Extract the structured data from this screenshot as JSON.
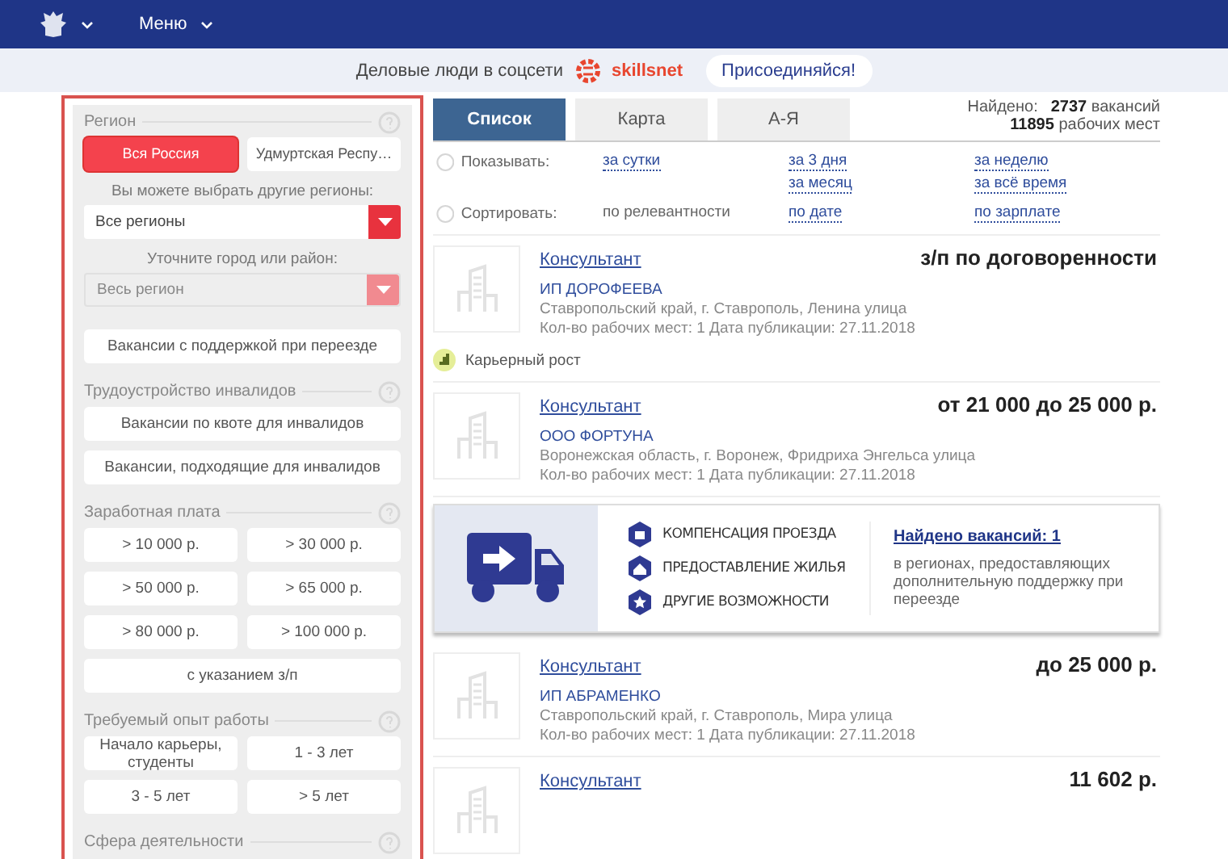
{
  "header": {
    "menu_label": "Меню"
  },
  "banner": {
    "text": "Деловые люди в соцсети",
    "brand": "skillsnet",
    "join_button": "Присоединяйся!"
  },
  "filters": {
    "sections": [
      {
        "kind": "region",
        "title": "Регион",
        "region_buttons": [
          {
            "label": "Вся Россия",
            "selected": true
          },
          {
            "label": "Удмуртская Респу…",
            "selected": false
          }
        ],
        "selects": [
          {
            "label": "Вы можете выбрать другие регионы:",
            "value": "Все регионы",
            "disabled": false
          },
          {
            "label": "Уточните город или район:",
            "value": "Весь регион",
            "disabled": true
          }
        ],
        "buttons": [
          {
            "label": "Вакансии с поддержкой при переезде",
            "selected": false
          }
        ]
      },
      {
        "kind": "buttons",
        "title": "Трудоустройство инвалидов",
        "buttons": [
          {
            "label": "Вакансии по квоте для инвалидов",
            "selected": false
          },
          {
            "label": "Вакансии, подходящие для инвалидов",
            "selected": false
          }
        ]
      },
      {
        "kind": "grid",
        "title": "Заработная плата",
        "buttons": [
          {
            "label": "> 10 000 р.",
            "selected": false
          },
          {
            "label": "> 30 000 р.",
            "selected": false
          },
          {
            "label": "> 50 000 р.",
            "selected": false
          },
          {
            "label": "> 65 000 р.",
            "selected": false
          },
          {
            "label": "> 80 000 р.",
            "selected": false
          },
          {
            "label": "> 100 000 р.",
            "selected": false
          },
          {
            "label": "с указанием з/п",
            "selected": false
          }
        ]
      },
      {
        "kind": "grid",
        "title": "Требуемый опыт работы",
        "buttons": [
          {
            "label": "Начало карьеры, студенты",
            "selected": false
          },
          {
            "label": "1 - 3 лет",
            "selected": false
          },
          {
            "label": "3 - 5 лет",
            "selected": false
          },
          {
            "label": "> 5 лет",
            "selected": false
          }
        ]
      },
      {
        "kind": "heading",
        "title": "Сфера деятельности"
      }
    ]
  },
  "view_tabs": [
    {
      "label": "Список",
      "selected": true
    },
    {
      "label": "Карта",
      "selected": false
    },
    {
      "label": "А-Я",
      "selected": false
    }
  ],
  "found": {
    "label": "Найдено:",
    "vacancies_count": "2737",
    "vacancies_label": "вакансий",
    "jobs_count": "11895",
    "jobs_label": "рабочих мест"
  },
  "show": {
    "label": "Показывать:",
    "options": [
      {
        "label": "за сутки",
        "selected": false
      },
      {
        "label": "за 3 дня",
        "selected": false
      },
      {
        "label": "за неделю",
        "selected": false
      },
      {
        "label": "за месяц",
        "selected": false
      },
      {
        "label": "за всё время",
        "selected": false
      }
    ]
  },
  "sort": {
    "label": "Сортировать:",
    "options": [
      {
        "label": "по релевантности",
        "selected": true
      },
      {
        "label": "по дате",
        "selected": false
      },
      {
        "label": "по зарплате",
        "selected": false
      }
    ]
  },
  "listing": [
    {
      "kind": "vacancy",
      "title": "Консультант",
      "salary": "з/п по договоренности",
      "company": "ИП ДОРОФЕЕВА",
      "address": "Ставропольский край, г. Ставрополь, Ленина улица",
      "meta": "Кол-во рабочих мест: 1  Дата публикации: 27.11.2018",
      "tags": [
        "Карьерный рост"
      ]
    },
    {
      "kind": "vacancy",
      "title": "Консультант",
      "salary": "от 21 000 до 25 000 р.",
      "company": "ООО ФОРТУНА",
      "address": "Воронежская область, г. Воронеж, Фридриха Энгельса улица",
      "meta": "Кол-во рабочих мест: 1  Дата публикации: 27.11.2018"
    },
    {
      "kind": "promo",
      "benefits": [
        "КОМПЕНСАЦИЯ ПРОЕЗДА",
        "ПРЕДОСТАВЛЕНИЕ ЖИЛЬЯ",
        "ДРУГИЕ ВОЗМОЖНОСТИ"
      ],
      "link": "Найдено вакансий: 1",
      "text": "в регионах, предоставляющих дополнительную поддержку при переезде"
    },
    {
      "kind": "vacancy",
      "title": "Консультант",
      "salary": "до 25 000 р.",
      "company": "ИП АБРАМЕНКО",
      "address": "Ставропольский край, г. Ставрополь, Мира улица",
      "meta": "Кол-во рабочих мест: 1  Дата публикации: 27.11.2018"
    },
    {
      "kind": "vacancy",
      "title": "Консультант",
      "salary": "11 602 р."
    }
  ]
}
